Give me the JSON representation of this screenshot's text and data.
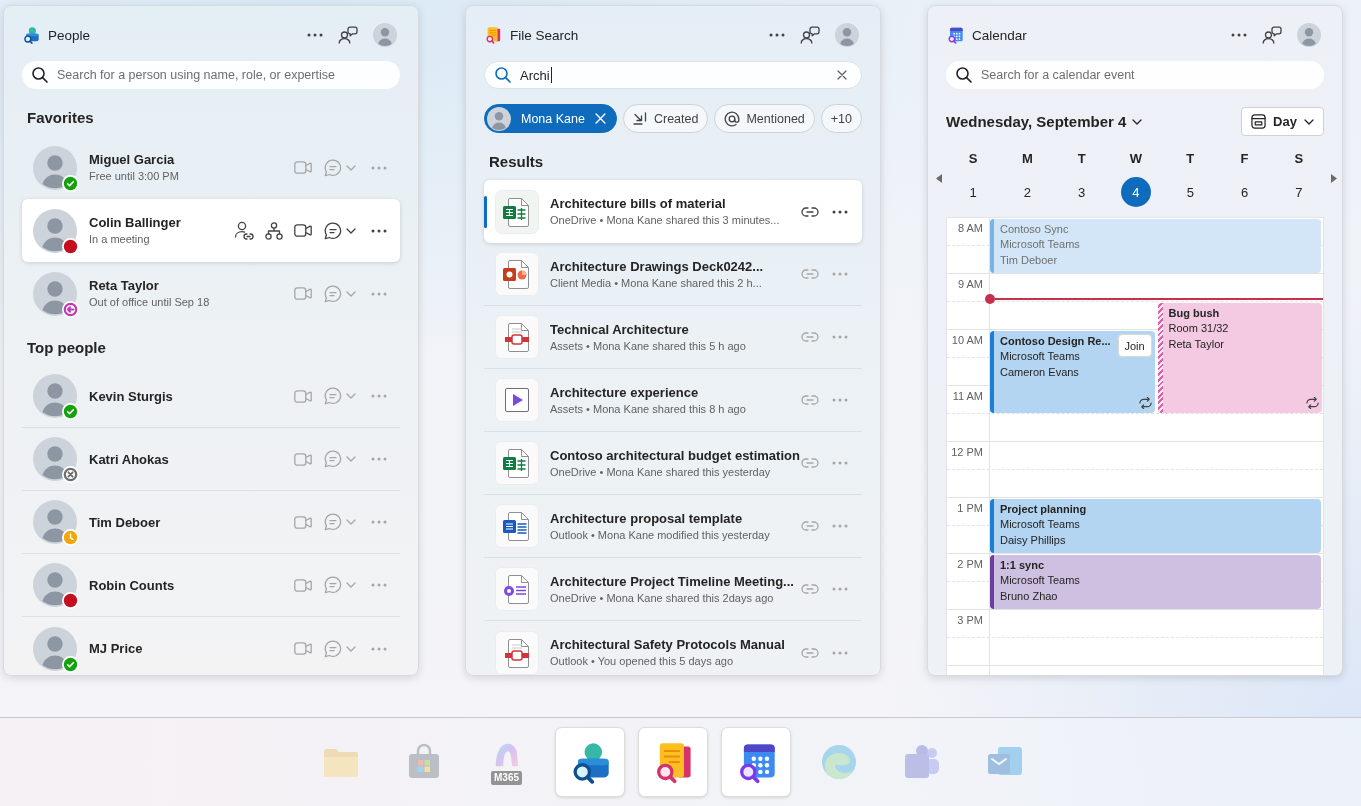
{
  "people_panel": {
    "title": "People",
    "search": {
      "placeholder": "Search for a person using name, role, or expertise"
    },
    "sections": [
      {
        "heading": "Favorites",
        "people": [
          {
            "name": "Miguel Garcia",
            "subtitle": "Free until 3:00 PM",
            "status": {
              "kind": "available",
              "color": "#13a10e"
            },
            "selected": false
          },
          {
            "name": "Colin Ballinger",
            "subtitle": "In a meeting",
            "status": {
              "kind": "busy",
              "color": "#c50f1f"
            },
            "selected": true
          },
          {
            "name": "Reta Taylor",
            "subtitle": "Out of office until Sep 18",
            "status": {
              "kind": "out-of-office",
              "color": "#c239b3"
            },
            "selected": false
          }
        ]
      },
      {
        "heading": "Top people",
        "people": [
          {
            "name": "Kevin Sturgis",
            "status": {
              "kind": "available",
              "color": "#13a10e"
            },
            "selected": false
          },
          {
            "name": "Katri Ahokas",
            "status": {
              "kind": "offline",
              "color": "#6e6e6e"
            },
            "selected": false
          },
          {
            "name": "Tim Deboer",
            "status": {
              "kind": "away",
              "color": "#f2a60c"
            },
            "selected": false
          },
          {
            "name": "Robin Counts",
            "status": {
              "kind": "busy",
              "color": "#c50f1f"
            },
            "selected": false
          },
          {
            "name": "MJ Price",
            "status": {
              "kind": "available",
              "color": "#13a10e"
            },
            "selected": false
          }
        ]
      }
    ]
  },
  "file_search_panel": {
    "title": "File Search",
    "search": {
      "value": "Archi"
    },
    "filters": [
      {
        "label": "Mona Kane",
        "kind": "person",
        "selected": true
      },
      {
        "label": "Created",
        "kind": "created",
        "selected": false
      },
      {
        "label": "Mentioned",
        "kind": "mentioned",
        "selected": false
      },
      {
        "label": "+10",
        "kind": "more",
        "selected": false
      }
    ],
    "results_heading": "Results",
    "results": [
      {
        "title": "Architecture bills of material",
        "details": "OneDrive • Mona Kane shared this 3 minutes...",
        "kind": "spreadsheet",
        "selected": true
      },
      {
        "title": "Architecture Drawings Deck0242...",
        "details": "Client Media • Mona Kane shared this 2 h...",
        "kind": "presentation",
        "selected": false
      },
      {
        "title": "Technical Architecture",
        "details": "Assets • Mona Kane shared this 5 h ago",
        "kind": "pdf",
        "selected": false
      },
      {
        "title": "Architecture experience",
        "details": "Assets • Mona Kane shared this 8 h ago",
        "kind": "video",
        "selected": false
      },
      {
        "title": "Contoso architectural budget estimation",
        "details": "OneDrive • Mona Kane shared this yesterday",
        "kind": "spreadsheet",
        "selected": false
      },
      {
        "title": "Architecture proposal template",
        "details": "Outlook • Mona Kane modified this yesterday",
        "kind": "document",
        "selected": false
      },
      {
        "title": "Architecture Project Timeline Meeting...",
        "details": "OneDrive • Mona Kane shared this 2days ago",
        "kind": "notes",
        "selected": false
      },
      {
        "title": "Architectural Safety Protocols Manual",
        "details": "Outlook • You opened this 5 days ago",
        "kind": "pdf",
        "selected": false
      }
    ]
  },
  "calendar_panel": {
    "title": "Calendar",
    "search": {
      "placeholder": "Search for a calendar event"
    },
    "date_title": "Wednesday, September 4",
    "view_button": "Day",
    "week": [
      {
        "day": "S",
        "date": "1",
        "selected": false
      },
      {
        "day": "M",
        "date": "2",
        "selected": false
      },
      {
        "day": "T",
        "date": "3",
        "selected": false
      },
      {
        "day": "W",
        "date": "4",
        "selected": true
      },
      {
        "day": "T",
        "date": "5",
        "selected": false
      },
      {
        "day": "F",
        "date": "6",
        "selected": false
      },
      {
        "day": "S",
        "date": "7",
        "selected": false
      }
    ],
    "hours": [
      {
        "label": "8 AM",
        "current_time": false,
        "events": [
          {
            "title": "Contoso Sync",
            "lines": [
              "Microsoft Teams",
              "Tim Deboer"
            ],
            "kind": "hour",
            "half_past": false,
            "color": "#7ab3e6",
            "past": true,
            "tentative": false,
            "recurring": false
          }
        ]
      },
      {
        "label": "9 AM",
        "current_time": true,
        "events": [
          {
            "title": "Bug bush",
            "lines": [
              "Room 31/32",
              "Reta Taylor"
            ],
            "kind": "double",
            "half_past": true,
            "color": "#dc5fa8",
            "past": false,
            "tentative": true,
            "recurring": true
          }
        ]
      },
      {
        "label": "10 AM",
        "current_time": false,
        "events": [
          {
            "title": "Contoso Design Re...",
            "lines": [
              "Microsoft Teams",
              "Cameron Evans"
            ],
            "kind": "ninety",
            "half_past": false,
            "color": "#1b7fd6",
            "past": false,
            "tentative": false,
            "recurring": true,
            "action": "Join"
          }
        ]
      },
      {
        "label": "11 AM",
        "current_time": false
      },
      {
        "label": "12 PM",
        "current_time": false
      },
      {
        "label": "1 PM",
        "current_time": false,
        "events": [
          {
            "title": "Project planning",
            "lines": [
              "Microsoft Teams",
              "Daisy Phillips"
            ],
            "kind": "hour",
            "half_past": false,
            "color": "#1b7fd6",
            "past": false,
            "tentative": false,
            "recurring": false
          }
        ]
      },
      {
        "label": "2 PM",
        "current_time": false,
        "events": [
          {
            "title": "1:1 sync",
            "lines": [
              "Microsoft Teams",
              "Bruno Zhao"
            ],
            "kind": "hour",
            "half_past": false,
            "color": "#6b3fa0",
            "past": false,
            "tentative": false,
            "recurring": false
          }
        ]
      },
      {
        "label": "3 PM",
        "current_time": false
      }
    ]
  },
  "taskbar": {
    "apps": [
      {
        "kind": "folder",
        "active": false
      },
      {
        "kind": "store",
        "active": false
      },
      {
        "kind": "m365",
        "badge": "M365",
        "active": false
      },
      {
        "kind": "people",
        "active": true
      },
      {
        "kind": "files",
        "active": true
      },
      {
        "kind": "calendar",
        "active": true
      },
      {
        "kind": "browser",
        "active": false
      },
      {
        "kind": "team-chat",
        "active": false
      },
      {
        "kind": "mail",
        "active": false
      }
    ]
  }
}
